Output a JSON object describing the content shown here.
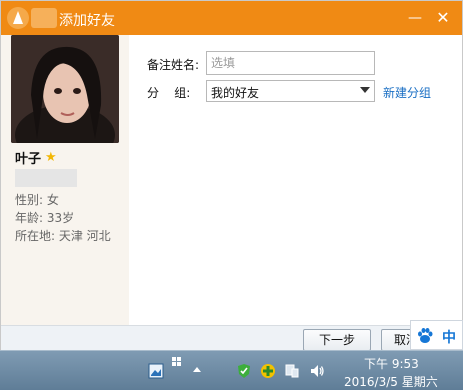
{
  "window": {
    "title": "添加好友",
    "minimize_label": "—",
    "close_label": "✕"
  },
  "profile": {
    "nickname": "叶子",
    "gender": "性别: 女",
    "age": "年龄: 33岁",
    "location": "所在地: 天津  河北"
  },
  "form": {
    "remark_label": "备注姓名:",
    "remark_placeholder": "选填",
    "group_label": "分    组:",
    "group_value": "我的好友",
    "new_group_link": "新建分组"
  },
  "buttons": {
    "next": "下一步",
    "cancel": "取消"
  },
  "ime": {
    "mode": "中"
  },
  "taskbar": {
    "time": "下午 9:53",
    "date": "2016/3/5 星期六"
  },
  "colors": {
    "titlebar": "#f08a14",
    "link": "#1a6fc4",
    "ime_blue": "#1677d6"
  }
}
